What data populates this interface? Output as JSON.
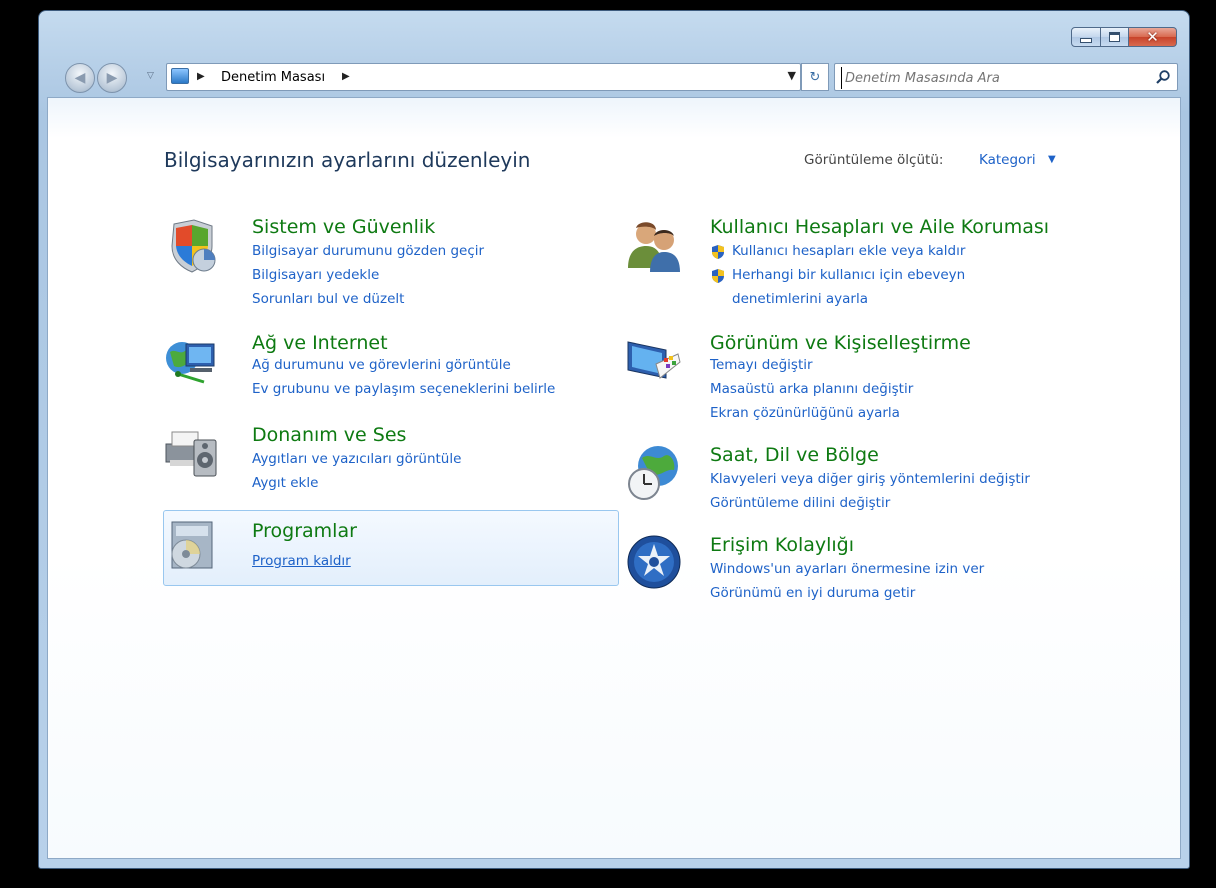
{
  "window": {
    "controls": {
      "minimize": "minimize",
      "maximize": "maximize",
      "close": "close"
    }
  },
  "nav": {
    "back_icon": "back-arrow-icon",
    "forward_icon": "forward-arrow-icon",
    "breadcrumb": [
      "Denetim Masası"
    ],
    "search_placeholder": "Denetim Masasında Ara"
  },
  "header": {
    "title": "Bilgisayarınızın ayarlarını düzenleyin",
    "view_by_label": "Görüntüleme ölçütü:",
    "view_by_value": "Kategori"
  },
  "left": [
    {
      "title": "Sistem ve Güvenlik",
      "icon": "shield-icon",
      "links": [
        "Bilgisayar durumunu gözden geçir",
        "Bilgisayarı yedekle",
        "Sorunları bul ve düzelt"
      ]
    },
    {
      "title": "Ağ ve Internet",
      "icon": "network-globe-icon",
      "links": [
        "Ağ durumunu ve görevlerini görüntüle",
        "Ev grubunu ve paylaşım seçeneklerini belirle"
      ]
    },
    {
      "title": "Donanım ve Ses",
      "icon": "printer-speaker-icon",
      "links": [
        "Aygıtları ve yazıcıları görüntüle",
        "Aygıt ekle"
      ]
    },
    {
      "title": "Programlar",
      "icon": "programs-disc-icon",
      "links": [
        "Program kaldır"
      ]
    }
  ],
  "right": [
    {
      "title": "Kullanıcı Hesapları ve Aile Koruması",
      "icon": "users-icon",
      "links": [
        "Kullanıcı hesapları ekle veya kaldır",
        "Herhangi bir kullanıcı için ebeveyn",
        "denetimlerini ayarla"
      ]
    },
    {
      "title": "Görünüm ve Kişiselleştirme",
      "icon": "monitor-palette-icon",
      "links": [
        "Temayı değiştir",
        "Masaüstü arka planını değiştir",
        "Ekran çözünürlüğünü ayarla"
      ]
    },
    {
      "title": "Saat, Dil ve Bölge",
      "icon": "clock-globe-icon",
      "links": [
        "Klavyeleri veya diğer giriş yöntemlerini değiştir",
        "Görüntüleme dilini değiştir"
      ]
    },
    {
      "title": "Erişim Kolaylığı",
      "icon": "accessibility-icon",
      "links": [
        "Windows'un ayarları önermesine izin ver",
        "Görünümü en iyi duruma getir"
      ]
    }
  ]
}
